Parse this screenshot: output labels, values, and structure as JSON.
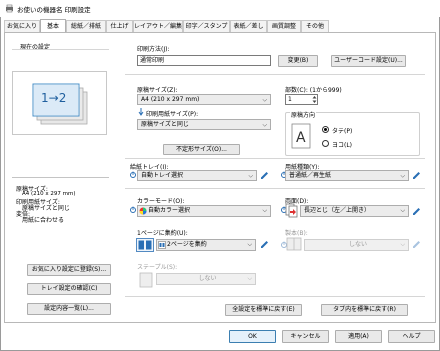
{
  "window": {
    "title": "お使いの機器名 印刷設定"
  },
  "tabs": [
    {
      "label": "お気に入り"
    },
    {
      "label": "基本"
    },
    {
      "label": "総紙／排紙"
    },
    {
      "label": "仕上げ"
    },
    {
      "label": "レイアウト／編集"
    },
    {
      "label": "印字／スタンプ"
    },
    {
      "label": "表紙／差し"
    },
    {
      "label": "画質調整"
    },
    {
      "label": "その他"
    }
  ],
  "left": {
    "current_settings_label": "現在の設定",
    "preview_text": "1→2",
    "summary": [
      "原稿サイズ:",
      "A4 (210 x 297 mm)",
      "印刷用紙サイズ:",
      "原稿サイズと同じ",
      "変倍:",
      "用紙に合わせる"
    ],
    "register_favorite_button": "お気に入り設定に登録(S)...",
    "tray_check_button": "トレイ設定の確認(C)",
    "settings_list_button": "設定内容一覧(L)..."
  },
  "main": {
    "print_method_label": "印刷方法(J):",
    "print_method_value": "通常印刷",
    "change_button": "変更(B)",
    "user_code_button": "ユーザーコード設定(U)...",
    "doc_size_label": "原稿サイズ(Z):",
    "doc_size_value": "A4 (210 x 297 mm)",
    "copies_label": "部数(C): (1から999)",
    "copies_value": "1",
    "paper_size_label": "印刷用紙サイズ(P):",
    "paper_size_value": "原稿サイズと同じ",
    "orientation_label": "原稿方向",
    "orientation_portrait": "タテ(P)",
    "orientation_landscape": "ヨコ(L)",
    "custom_size_button": "不定形サイズ(O)...",
    "input_tray_label": "給紙トレイ(I):",
    "input_tray_value": "自動トレイ選択",
    "paper_type_label": "用紙種類(Y):",
    "paper_type_value": "普通紙／再生紙",
    "color_mode_label": "カラーモード(O):",
    "color_mode_value": "自動カラー選択",
    "duplex_label": "両面(D):",
    "duplex_value": "長辺とじ（左／上開き）",
    "nup_label": "1ページに集約(U):",
    "nup_value": "2ページを集約",
    "booklet_label": "製本(B):",
    "booklet_value": "しない",
    "staple_label": "ステープル(S):",
    "staple_value": "しない",
    "reset_all_button": "全設定を標準に戻す(E)",
    "reset_tab_button": "タブ内を標準に戻す(R)"
  },
  "footer": {
    "ok_button": "OK",
    "cancel_button": "キャンセル",
    "apply_button": "適用(A)",
    "help_button": "ヘルプ"
  },
  "colors": {
    "accent": "#2a6fb5",
    "panel_border": "#b8b8b8",
    "button_bg": "#e9e9e9"
  }
}
